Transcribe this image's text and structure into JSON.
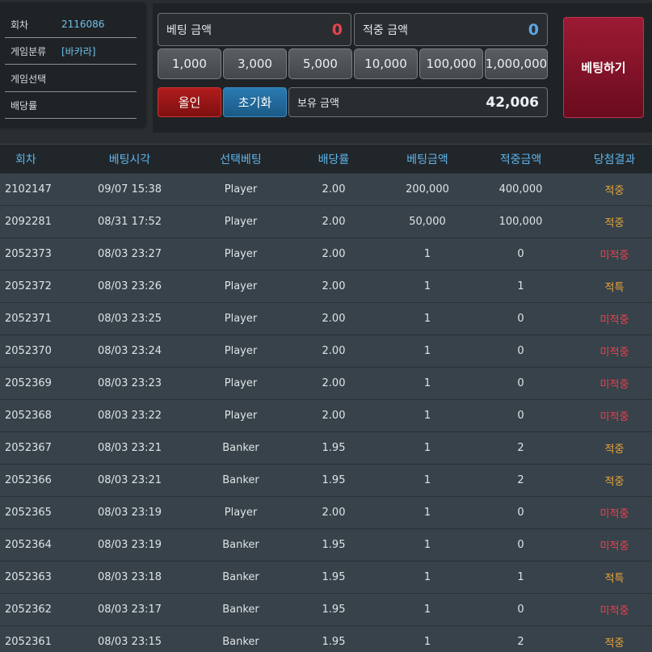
{
  "info": {
    "round_label": "회차",
    "round_value": "2116086",
    "category_label": "게임분류",
    "category_value": "[바카라]",
    "select_label": "게임선택",
    "select_value": "",
    "odds_label": "배당률",
    "odds_value": ""
  },
  "bet": {
    "bet_amount_label": "베팅 금액",
    "bet_amount_value": "0",
    "win_amount_label": "적중 금액",
    "win_amount_value": "0",
    "chips": [
      "1,000",
      "3,000",
      "5,000",
      "10,000",
      "100,000",
      "1,000,000"
    ],
    "allin_label": "올인",
    "reset_label": "초기화",
    "balance_label": "보유 금액",
    "balance_value": "42,006",
    "bet_button_label": "베팅하기"
  },
  "colors": {
    "bet_amount": "#e8424f",
    "win_amount": "#5aa6e6",
    "win": "#e8a53a",
    "lose": "#e8424f"
  },
  "table": {
    "headers": [
      "회차",
      "베팅시각",
      "선택베팅",
      "배당률",
      "베팅금액",
      "적중금액",
      "당첨결과"
    ],
    "rows": [
      {
        "round": "2102147",
        "time": "09/07 15:38",
        "pick": "Player",
        "odds": "2.00",
        "bet": "200,000",
        "win": "400,000",
        "result": "적중",
        "status": "win"
      },
      {
        "round": "2092281",
        "time": "08/31 17:52",
        "pick": "Player",
        "odds": "2.00",
        "bet": "50,000",
        "win": "100,000",
        "result": "적중",
        "status": "win"
      },
      {
        "round": "2052373",
        "time": "08/03 23:27",
        "pick": "Player",
        "odds": "2.00",
        "bet": "1",
        "win": "0",
        "result": "미적중",
        "status": "lose"
      },
      {
        "round": "2052372",
        "time": "08/03 23:26",
        "pick": "Player",
        "odds": "2.00",
        "bet": "1",
        "win": "1",
        "result": "적특",
        "status": "win"
      },
      {
        "round": "2052371",
        "time": "08/03 23:25",
        "pick": "Player",
        "odds": "2.00",
        "bet": "1",
        "win": "0",
        "result": "미적중",
        "status": "lose"
      },
      {
        "round": "2052370",
        "time": "08/03 23:24",
        "pick": "Player",
        "odds": "2.00",
        "bet": "1",
        "win": "0",
        "result": "미적중",
        "status": "lose"
      },
      {
        "round": "2052369",
        "time": "08/03 23:23",
        "pick": "Player",
        "odds": "2.00",
        "bet": "1",
        "win": "0",
        "result": "미적중",
        "status": "lose"
      },
      {
        "round": "2052368",
        "time": "08/03 23:22",
        "pick": "Player",
        "odds": "2.00",
        "bet": "1",
        "win": "0",
        "result": "미적중",
        "status": "lose"
      },
      {
        "round": "2052367",
        "time": "08/03 23:21",
        "pick": "Banker",
        "odds": "1.95",
        "bet": "1",
        "win": "2",
        "result": "적중",
        "status": "win"
      },
      {
        "round": "2052366",
        "time": "08/03 23:21",
        "pick": "Banker",
        "odds": "1.95",
        "bet": "1",
        "win": "2",
        "result": "적중",
        "status": "win"
      },
      {
        "round": "2052365",
        "time": "08/03 23:19",
        "pick": "Player",
        "odds": "2.00",
        "bet": "1",
        "win": "0",
        "result": "미적중",
        "status": "lose"
      },
      {
        "round": "2052364",
        "time": "08/03 23:19",
        "pick": "Banker",
        "odds": "1.95",
        "bet": "1",
        "win": "0",
        "result": "미적중",
        "status": "lose"
      },
      {
        "round": "2052363",
        "time": "08/03 23:18",
        "pick": "Banker",
        "odds": "1.95",
        "bet": "1",
        "win": "1",
        "result": "적특",
        "status": "win"
      },
      {
        "round": "2052362",
        "time": "08/03 23:17",
        "pick": "Banker",
        "odds": "1.95",
        "bet": "1",
        "win": "0",
        "result": "미적중",
        "status": "lose"
      },
      {
        "round": "2052361",
        "time": "08/03 23:15",
        "pick": "Banker",
        "odds": "1.95",
        "bet": "1",
        "win": "2",
        "result": "적중",
        "status": "win"
      }
    ]
  }
}
